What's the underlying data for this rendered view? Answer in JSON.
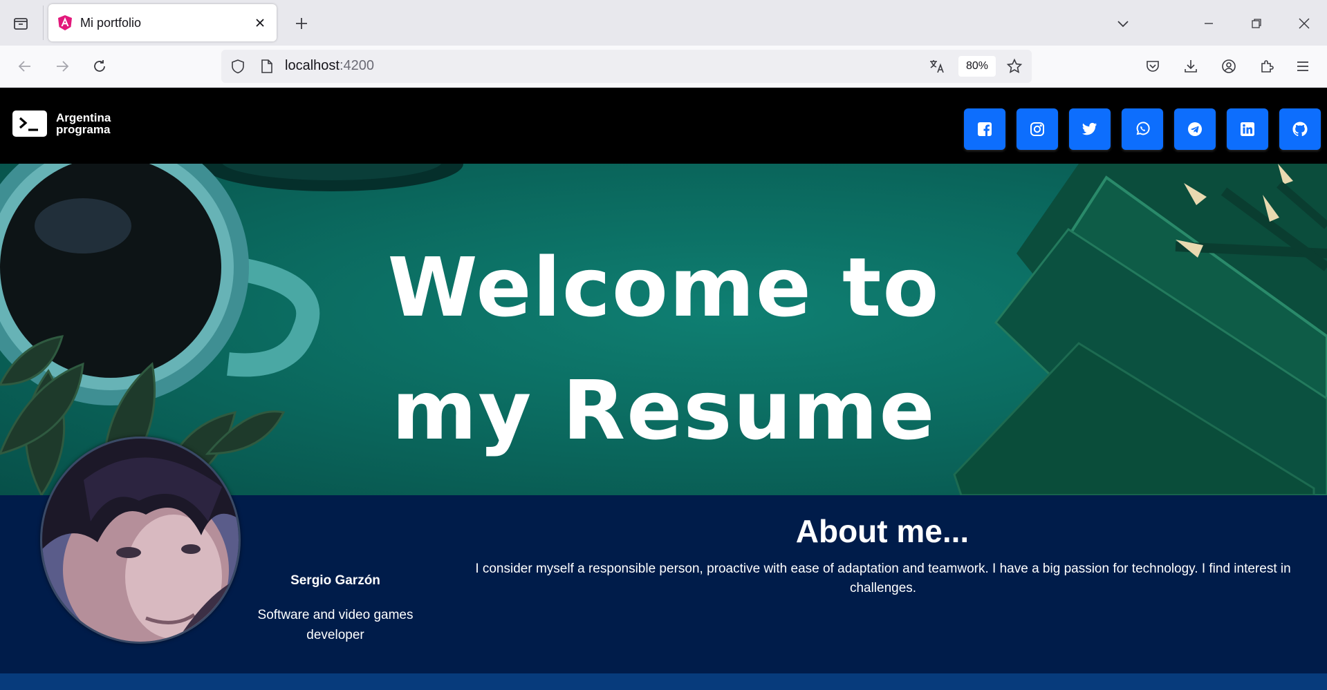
{
  "browser": {
    "tab_title": "Mi portfolio",
    "url_host": "localhost",
    "url_port": ":4200",
    "zoom": "80%"
  },
  "header": {
    "brand_line1": "Argentina",
    "brand_line2": "programa",
    "social_icons": [
      "facebook-icon",
      "instagram-icon",
      "twitter-icon",
      "whatsapp-icon",
      "telegram-icon",
      "linkedin-icon",
      "github-icon"
    ],
    "button_color": "#0d6efd"
  },
  "hero": {
    "line1": "Welcome to",
    "line2": "my Resume"
  },
  "profile": {
    "name": "Sergio Garzón",
    "role": "Software and video games developer"
  },
  "about": {
    "title": "About me...",
    "text": "I consider myself a responsible person, proactive with ease of adaptation and teamwork. I have a big passion for technology. I find interest in challenges."
  },
  "colors": {
    "header_bg": "#000000",
    "about_bg": "#001c4a",
    "hero_teal": "#0b6b60"
  }
}
